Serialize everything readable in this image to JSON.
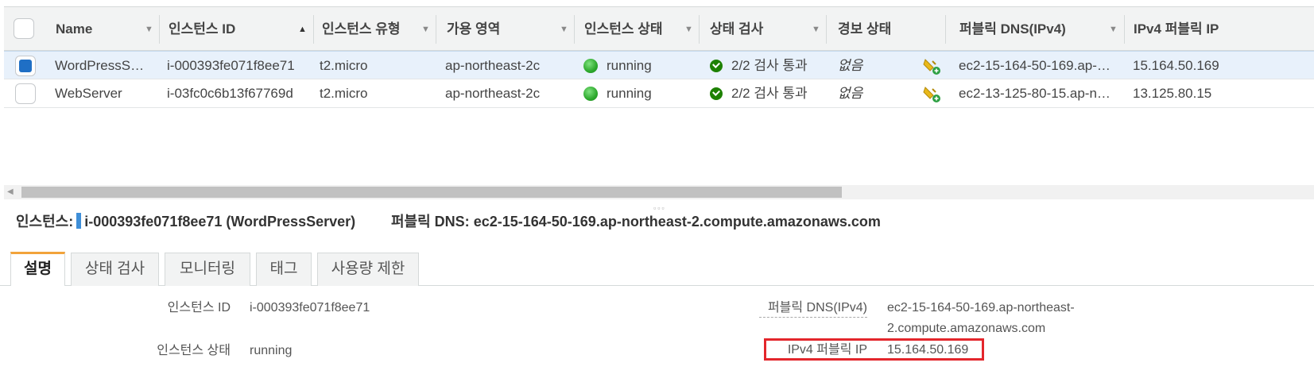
{
  "table": {
    "headers": {
      "name": "Name",
      "instance_id": "인스턴스 ID",
      "instance_type": "인스턴스 유형",
      "az": "가용 영역",
      "instance_state": "인스턴스 상태",
      "status_check": "상태 검사",
      "alarm_status": "경보 상태",
      "public_dns": "퍼블릭 DNS(IPv4)",
      "public_ip": "IPv4 퍼블릭 IP"
    },
    "rows": [
      {
        "selected": true,
        "name": "WordPressS…",
        "instance_id": "i-000393fe071f8ee71",
        "instance_type": "t2.micro",
        "az": "ap-northeast-2c",
        "state": "running",
        "status_check": "2/2 검사 통과",
        "alarm": "없음",
        "public_dns": "ec2-15-164-50-169.ap-…",
        "public_ip": "15.164.50.169"
      },
      {
        "selected": false,
        "name": "WebServer",
        "instance_id": "i-03fc0c6b13f67769d",
        "instance_type": "t2.micro",
        "az": "ap-northeast-2c",
        "state": "running",
        "status_check": "2/2 검사 통과",
        "alarm": "없음",
        "public_dns": "ec2-13-125-80-15.ap-n…",
        "public_ip": "13.125.80.15"
      }
    ]
  },
  "details": {
    "instance_prefix": "인스턴스:",
    "instance_value": "i-000393fe071f8ee71 (WordPressServer)",
    "dns_prefix": "퍼블릭 DNS:",
    "dns_value": "ec2-15-164-50-169.ap-northeast-2.compute.amazonaws.com",
    "tabs": [
      "설명",
      "상태 검사",
      "모니터링",
      "태그",
      "사용량 제한"
    ],
    "fields": {
      "instance_id_label": "인스턴스 ID",
      "instance_id_value": "i-000393fe071f8ee71",
      "instance_state_label": "인스턴스 상태",
      "instance_state_value": "running",
      "public_dns_label": "퍼블릭 DNS(IPv4)",
      "public_dns_value_line1": "ec2-15-164-50-169.ap-northeast-",
      "public_dns_value_line2": "2.compute.amazonaws.com",
      "public_ip_label": "IPv4 퍼블릭 IP",
      "public_ip_value": "15.164.50.169"
    }
  },
  "colors": {
    "selected_row": "#e8f1fb",
    "running_dot": "#2ca82c",
    "check_ok": "#1d8102",
    "active_tab_accent": "#f2a33a",
    "highlight": "#e3262c",
    "instance_bar": "#3f8fd8"
  },
  "icons": {
    "alarm": "alarm-bell-add-icon",
    "running": "green-dot-icon",
    "status_ok": "check-circle-icon"
  }
}
